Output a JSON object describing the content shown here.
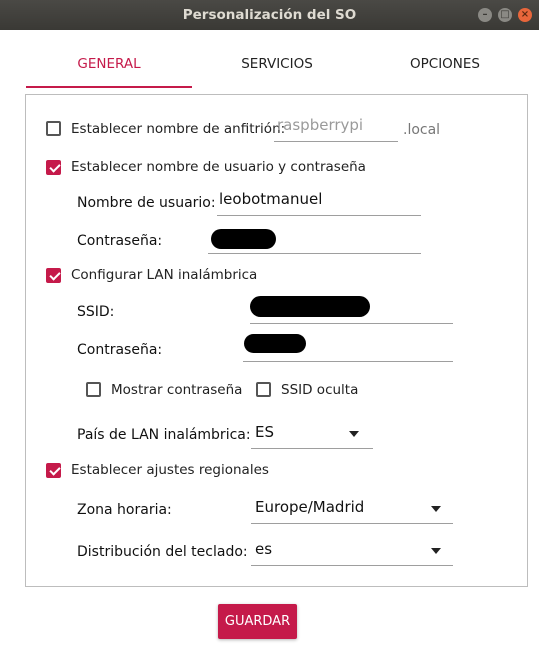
{
  "window": {
    "title": "Personalización del SO"
  },
  "tabs": [
    {
      "label": "GENERAL",
      "active": true
    },
    {
      "label": "SERVICIOS",
      "active": false
    },
    {
      "label": "OPCIONES",
      "active": false
    }
  ],
  "hostname": {
    "label": "Establecer nombre de anfitrión:",
    "checked": false,
    "placeholder": "raspberrypi",
    "suffix": ".local"
  },
  "user": {
    "label": "Establecer nombre de usuario y contraseña",
    "checked": true,
    "username_label": "Nombre de usuario:",
    "username_value": "leobotmanuel",
    "password_label": "Contraseña:"
  },
  "wifi": {
    "label": "Configurar LAN inalámbrica",
    "checked": true,
    "ssid_label": "SSID:",
    "password_label": "Contraseña:",
    "show_password_label": "Mostrar contraseña",
    "show_password_checked": false,
    "hidden_ssid_label": "SSID oculta",
    "hidden_ssid_checked": false,
    "country_label": "País de LAN inalámbrica:",
    "country_value": "ES"
  },
  "locale": {
    "label": "Establecer ajustes regionales",
    "checked": true,
    "timezone_label": "Zona horaria:",
    "timezone_value": "Europe/Madrid",
    "keyboard_label": "Distribución del teclado:",
    "keyboard_value": "es"
  },
  "actions": {
    "save_label": "GUARDAR"
  },
  "colors": {
    "accent": "#c51a4a",
    "titlebar": "#3d3c38"
  }
}
